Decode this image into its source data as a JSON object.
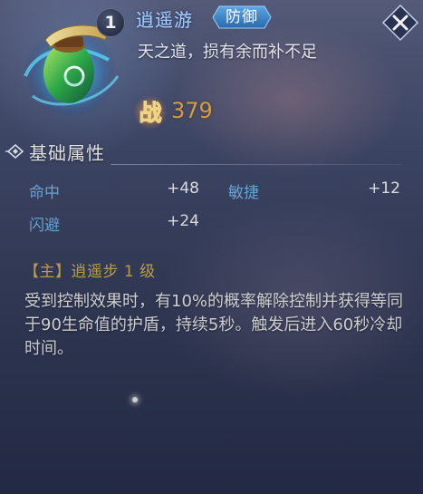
{
  "header": {
    "level": "1",
    "item_name": "逍遥游",
    "type_tag": "防御",
    "motto": "天之道，损有余而补不足",
    "power_icon_text": "战",
    "power_value": "379"
  },
  "basic_attributes": {
    "title": "基础属性",
    "rows": [
      {
        "left_name": "命中",
        "left_value": "+48",
        "right_name": "敏捷",
        "right_value": "+12"
      },
      {
        "left_name": "闪避",
        "left_value": "+24"
      }
    ]
  },
  "skill": {
    "title_line": "【主】逍遥步 1 级",
    "description": "受到控制效果时，有10%的概率解除控制并获得等同于90生命值的护盾，持续5秒。触发后进入60秒冷却时间。"
  },
  "icons": {
    "item": "scroll-gourd-icon",
    "close": "close-icon",
    "power": "battle-power-icon",
    "section": "diamond-bullet-icon"
  },
  "colors": {
    "item_name": "#a9d3ff",
    "attr_name": "#6fb3e8",
    "power_value": "#d9a64e",
    "skill_title": "#d6b24c",
    "type_tag_bg": "#3f86c9"
  }
}
